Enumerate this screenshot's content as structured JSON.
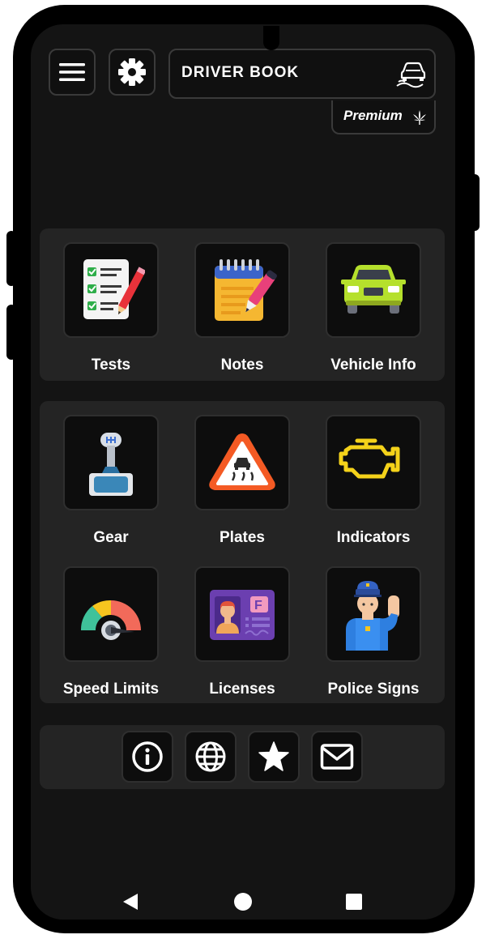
{
  "header": {
    "menu_icon": "hamburger-menu-icon",
    "settings_icon": "gear-icon",
    "title": "DRIVER BOOK",
    "title_icon": "skidding-car-icon",
    "premium_label": "Premium",
    "premium_icon": "leaf-icon"
  },
  "sections": {
    "top": [
      {
        "label": "Tests",
        "icon": "checklist-icon"
      },
      {
        "label": "Notes",
        "icon": "notepad-icon"
      },
      {
        "label": "Vehicle Info",
        "icon": "car-icon"
      }
    ],
    "middle": [
      {
        "label": "Gear",
        "icon": "gear-stick-icon"
      },
      {
        "label": "Plates",
        "icon": "slippery-road-sign-icon"
      },
      {
        "label": "Indicators",
        "icon": "engine-warning-icon"
      },
      {
        "label": "Speed Limits",
        "icon": "speedometer-icon"
      },
      {
        "label": "Licenses",
        "icon": "license-card-icon"
      },
      {
        "label": "Police Signs",
        "icon": "police-officer-icon"
      }
    ]
  },
  "license_letter": "F",
  "bottom_bar": [
    "info-icon",
    "globe-icon",
    "star-icon",
    "mail-icon"
  ],
  "nav_bar": [
    "back-icon",
    "home-icon",
    "recents-icon"
  ],
  "colors": {
    "background": "#141414",
    "panel": "#242424",
    "tile": "#0d0d0d",
    "text": "#ffffff"
  }
}
